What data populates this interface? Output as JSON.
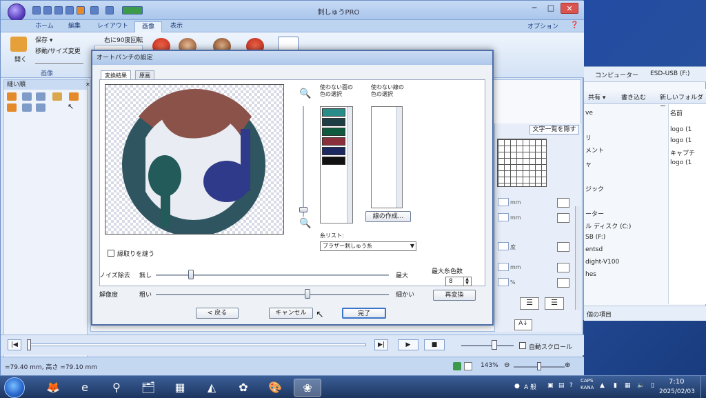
{
  "app": {
    "title": "刺しゅうPRO",
    "tabs": [
      "ホーム",
      "編集",
      "レイアウト",
      "画像",
      "表示"
    ],
    "active_tab": "画像",
    "options_label": "オプション",
    "window_controls": {
      "minimize": "─",
      "maximize": "□",
      "close": "✕"
    }
  },
  "ribbon": {
    "open_label": "開く",
    "save_label": "保存 ▾",
    "resize_label": "移動/サイズ変更",
    "rotate_label": "右に90度回転",
    "group_label": "画像"
  },
  "left_panel": {
    "title": "縫い順"
  },
  "explorer": {
    "breadcrumb_computer": "コンピューター",
    "breadcrumb_drive": "ESD-USB (F:)",
    "toolbar": {
      "share": "共有 ▾",
      "burn": "書き込む",
      "new_folder": "新しいフォルダー"
    },
    "column_name": "名前",
    "nav_items": [
      "ve",
      "リ",
      "メント",
      "ャ",
      "ジック",
      "ーター",
      "ル ディスク (C:)",
      "SB (F:)",
      "entsd",
      "dight-V100",
      "hes"
    ],
    "files": [
      "logo (1",
      "logo (1",
      "キャプチ",
      "logo (1"
    ],
    "status": "個の項目"
  },
  "properties": {
    "hide_text_list_button": "文字一覧を隠す",
    "mm_unit": "mm",
    "deg_unit": "度",
    "percent_unit": "%"
  },
  "player": {
    "auto_scroll_label": "自動スクロール"
  },
  "status_bar": {
    "dimensions": "=79.40 mm, 高さ =79.10 mm",
    "zoom": "143%"
  },
  "dialog": {
    "title": "オートパンチの設定",
    "tabs": [
      "変換結果",
      "原画"
    ],
    "active_tab": "変換結果",
    "unused_face_label": "使わない面の\n色の選択",
    "unused_line_label": "使わない線の\n色の選択",
    "create_line_button": "線の作成...",
    "thread_list_label": "糸リスト:",
    "thread_list_value": "ブラザー刺しゅう糸",
    "sew_outline_label": "縁取りを縫う",
    "noise_label": "ノイズ除去",
    "noise_min": "無し",
    "noise_max": "最大",
    "noise_value": 0.15,
    "resolution_label": "解像度",
    "resolution_min": "粗い",
    "resolution_max": "細かい",
    "resolution_value": 0.65,
    "max_colors_label": "最大糸色数",
    "max_colors_value": "8",
    "reconvert_button": "再変換",
    "back_button": "< 戻る",
    "cancel_button": "キャンセル",
    "finish_button": "完了",
    "colors": [
      "#2a8c88",
      "#1d3e45",
      "#0f5a3f",
      "#8b2f3b",
      "#1c2860",
      "#111111"
    ]
  },
  "taskbar": {
    "ime_label": "A 般",
    "caps_label": "CAPS",
    "kana_label": "KANA",
    "time": "7:10",
    "date": "2025/02/03"
  }
}
